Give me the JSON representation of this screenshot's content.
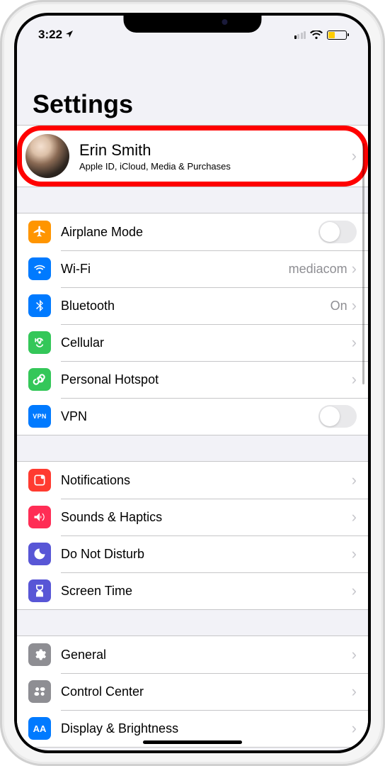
{
  "status": {
    "time": "3:22",
    "location_arrow": "↗"
  },
  "page_title": "Settings",
  "profile": {
    "name": "Erin Smith",
    "subtitle": "Apple ID, iCloud, Media & Purchases"
  },
  "groups": [
    {
      "items": [
        {
          "id": "airplane-mode",
          "label": "Airplane Mode",
          "icon_bg": "#ff9500",
          "accessory": "toggle",
          "value": false
        },
        {
          "id": "wifi",
          "label": "Wi-Fi",
          "icon_bg": "#007aff",
          "accessory": "disclosure",
          "detail": "mediacom"
        },
        {
          "id": "bluetooth",
          "label": "Bluetooth",
          "icon_bg": "#007aff",
          "accessory": "disclosure",
          "detail": "On"
        },
        {
          "id": "cellular",
          "label": "Cellular",
          "icon_bg": "#34c759",
          "accessory": "disclosure"
        },
        {
          "id": "personal-hotspot",
          "label": "Personal Hotspot",
          "icon_bg": "#34c759",
          "accessory": "disclosure"
        },
        {
          "id": "vpn",
          "label": "VPN",
          "icon_bg": "#007aff",
          "accessory": "toggle",
          "value": false,
          "badge": "VPN"
        }
      ]
    },
    {
      "items": [
        {
          "id": "notifications",
          "label": "Notifications",
          "icon_bg": "#ff3b30",
          "accessory": "disclosure"
        },
        {
          "id": "sounds-haptics",
          "label": "Sounds & Haptics",
          "icon_bg": "#ff2d55",
          "accessory": "disclosure"
        },
        {
          "id": "do-not-disturb",
          "label": "Do Not Disturb",
          "icon_bg": "#5856d6",
          "accessory": "disclosure"
        },
        {
          "id": "screen-time",
          "label": "Screen Time",
          "icon_bg": "#5856d6",
          "accessory": "disclosure"
        }
      ]
    },
    {
      "items": [
        {
          "id": "general",
          "label": "General",
          "icon_bg": "#8e8e93",
          "accessory": "disclosure"
        },
        {
          "id": "control-center",
          "label": "Control Center",
          "icon_bg": "#8e8e93",
          "accessory": "disclosure"
        },
        {
          "id": "display-brightness",
          "label": "Display & Brightness",
          "icon_bg": "#007aff",
          "accessory": "disclosure",
          "badge": "AA"
        }
      ]
    }
  ]
}
